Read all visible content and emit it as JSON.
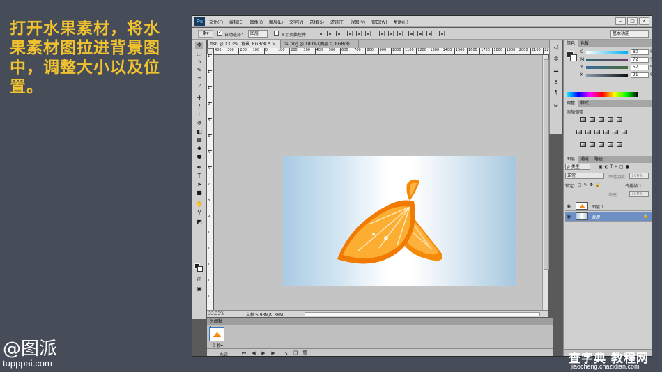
{
  "slide": {
    "instruction": "打开水果素材，将水果素材图拉进背景图中，调整大小以及位置。",
    "brand_mark": "@图派",
    "brand_url": "tupppai.com",
    "watermark_main": "查字典 教程网",
    "watermark_url": "jiaocheng.chazidian.com",
    "accent_color": "#f1c230"
  },
  "app": {
    "logo": "Ps",
    "menu": [
      "文件(F)",
      "编辑(E)",
      "图像(I)",
      "图层(L)",
      "文字(Y)",
      "选择(S)",
      "滤镜(T)",
      "视图(V)",
      "窗口(W)",
      "帮助(H)"
    ],
    "window_controls": [
      "–",
      "□",
      "×"
    ]
  },
  "options_bar": {
    "auto_select_label": "自动选择：",
    "auto_select_value": "图层",
    "show_transform_label": "显示变换控件",
    "workspace": "基本功能"
  },
  "tabs": [
    {
      "label": "fish @ 33.3% (背景, RGB/8) *",
      "active": true
    },
    {
      "label": "04.png @ 100% (图层 0, RGB/8) *",
      "active": false
    }
  ],
  "ruler": {
    "h_ticks": [
      "400",
      "300",
      "200",
      "100",
      "0",
      "100",
      "200",
      "300",
      "400",
      "500",
      "600",
      "700",
      "800",
      "900",
      "1000",
      "1100",
      "1200",
      "1300",
      "1400",
      "1500",
      "1600",
      "1700",
      "1800",
      "1900",
      "2000",
      "2100",
      "2200"
    ],
    "v_ticks": [
      "1",
      "1",
      "1",
      "2",
      "3",
      "4",
      "5",
      "6",
      "7",
      "8",
      "9",
      "1",
      "1",
      "1",
      "1",
      "1"
    ]
  },
  "status": {
    "zoom": "33.33%",
    "doc": "文档:5.93M/9.38M"
  },
  "timeline": {
    "title": "时间轴",
    "frame_label": "1",
    "frame_time": "0 秒▾",
    "loop": "永远"
  },
  "color_panel": {
    "tabs": [
      "颜色",
      "色板"
    ],
    "rows": [
      {
        "label": "C",
        "value": "80",
        "unit": "%"
      },
      {
        "label": "M",
        "value": "72",
        "unit": "%"
      },
      {
        "label": "Y",
        "value": "57",
        "unit": "%"
      },
      {
        "label": "K",
        "value": "21",
        "unit": "%"
      }
    ]
  },
  "adjust_panel": {
    "tabs": [
      "调整",
      "样式"
    ],
    "title": "添加调整"
  },
  "layers_panel": {
    "tabs": [
      "图层",
      "通道",
      "路径"
    ],
    "filter": "ρ 类型",
    "blend_mode": "正常",
    "opacity_label": "不透明度:",
    "opacity_value": "100%",
    "lock_label": "锁定:",
    "propagate_label": "传播帧 1",
    "fill_label": "填充:",
    "fill_value": "100%",
    "layers": [
      {
        "name": "图层 1",
        "selected": false
      },
      {
        "name": "背景",
        "selected": true
      }
    ]
  }
}
